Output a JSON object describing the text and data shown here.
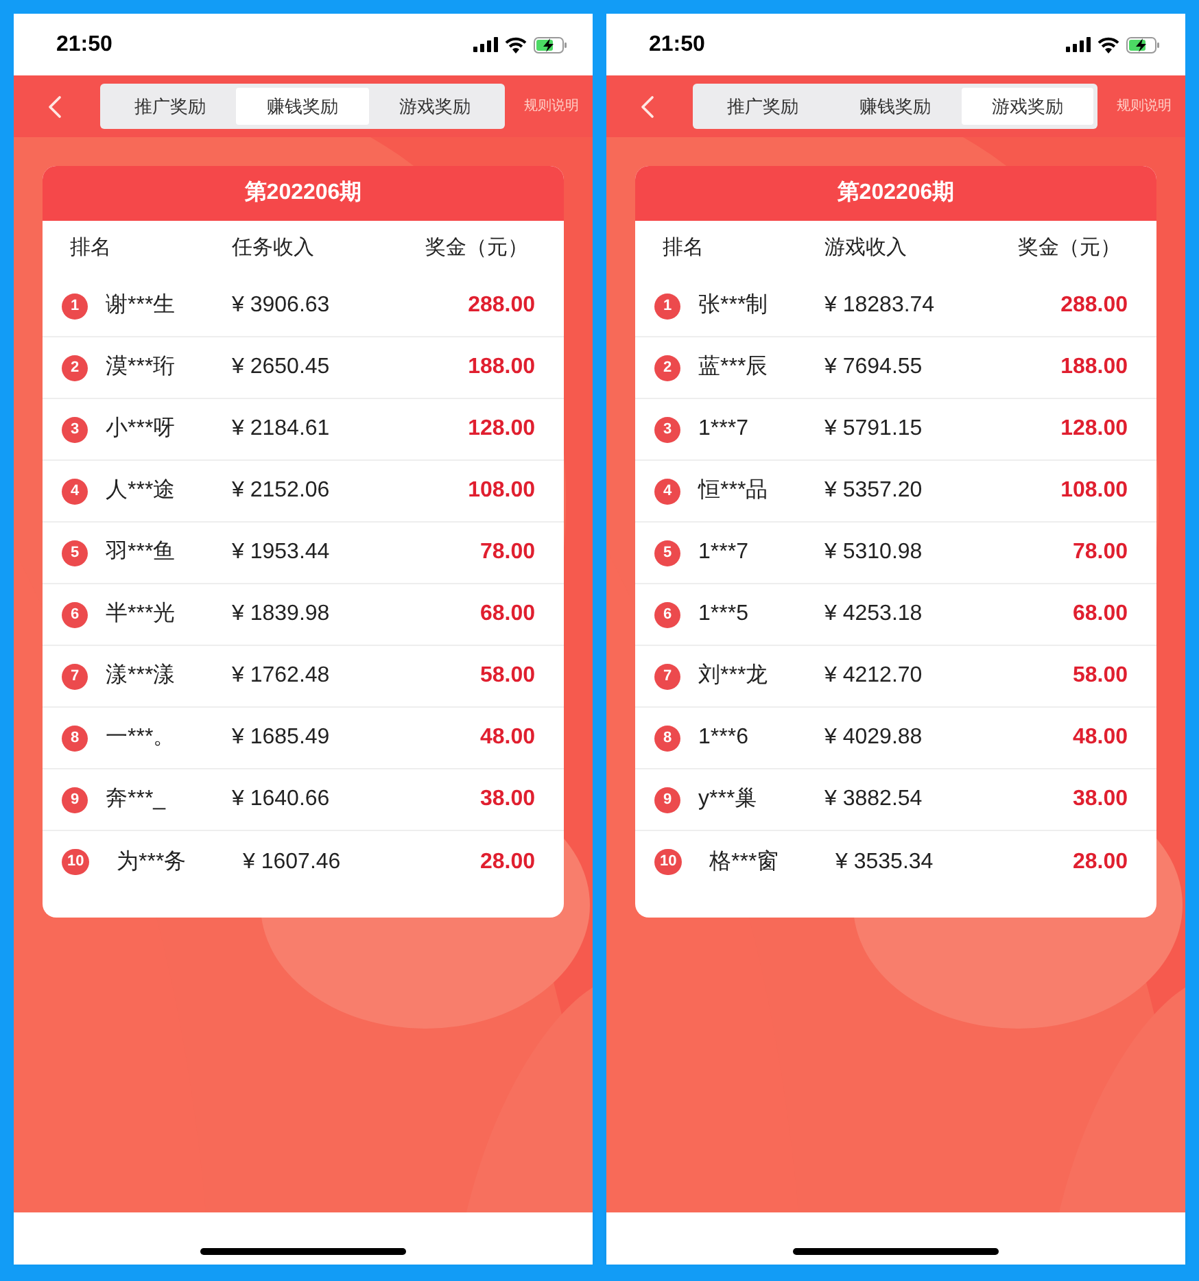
{
  "phones": [
    {
      "status_time": "21:50",
      "tabs": [
        {
          "label": "推广奖励",
          "selected": false
        },
        {
          "label": "赚钱奖励",
          "selected": true
        },
        {
          "label": "游戏奖励",
          "selected": false
        }
      ],
      "rules_link": "规则说明",
      "period": "第202206期",
      "columns": [
        "排名",
        "任务收入",
        "奖金（元）"
      ],
      "rows": [
        {
          "rank": "1",
          "name": "谢***生",
          "income": "¥ 3906.63",
          "prize": "288.00"
        },
        {
          "rank": "2",
          "name": "漠***珩",
          "income": "¥ 2650.45",
          "prize": "188.00"
        },
        {
          "rank": "3",
          "name": "小***呀",
          "income": "¥ 2184.61",
          "prize": "128.00"
        },
        {
          "rank": "4",
          "name": "人***途",
          "income": "¥ 2152.06",
          "prize": "108.00"
        },
        {
          "rank": "5",
          "name": "羽***鱼",
          "income": "¥ 1953.44",
          "prize": "78.00"
        },
        {
          "rank": "6",
          "name": "半***光",
          "income": "¥ 1839.98",
          "prize": "68.00"
        },
        {
          "rank": "7",
          "name": "漾***漾",
          "income": "¥ 1762.48",
          "prize": "58.00"
        },
        {
          "rank": "8",
          "name": "一***。",
          "income": "¥ 1685.49",
          "prize": "48.00"
        },
        {
          "rank": "9",
          "name": "奔***_",
          "income": "¥ 1640.66",
          "prize": "38.00"
        },
        {
          "rank": "10",
          "name": "为***务",
          "income": "¥ 1607.46",
          "prize": "28.00"
        }
      ]
    },
    {
      "status_time": "21:50",
      "tabs": [
        {
          "label": "推广奖励",
          "selected": false
        },
        {
          "label": "赚钱奖励",
          "selected": false
        },
        {
          "label": "游戏奖励",
          "selected": true
        }
      ],
      "rules_link": "规则说明",
      "period": "第202206期",
      "columns": [
        "排名",
        "游戏收入",
        "奖金（元）"
      ],
      "rows": [
        {
          "rank": "1",
          "name": "张***制",
          "income": "¥ 18283.74",
          "prize": "288.00"
        },
        {
          "rank": "2",
          "name": "蓝***辰",
          "income": "¥ 7694.55",
          "prize": "188.00"
        },
        {
          "rank": "3",
          "name": "1***7",
          "income": "¥ 5791.15",
          "prize": "128.00"
        },
        {
          "rank": "4",
          "name": "恒***品",
          "income": "¥ 5357.20",
          "prize": "108.00"
        },
        {
          "rank": "5",
          "name": "1***7",
          "income": "¥ 5310.98",
          "prize": "78.00"
        },
        {
          "rank": "6",
          "name": "1***5",
          "income": "¥ 4253.18",
          "prize": "68.00"
        },
        {
          "rank": "7",
          "name": "刘***龙",
          "income": "¥ 4212.70",
          "prize": "58.00"
        },
        {
          "rank": "8",
          "name": "1***6",
          "income": "¥ 4029.88",
          "prize": "48.00"
        },
        {
          "rank": "9",
          "name": "y***巢",
          "income": "¥ 3882.54",
          "prize": "38.00"
        },
        {
          "rank": "10",
          "name": "格***窗",
          "income": "¥ 3535.34",
          "prize": "28.00"
        }
      ]
    }
  ]
}
